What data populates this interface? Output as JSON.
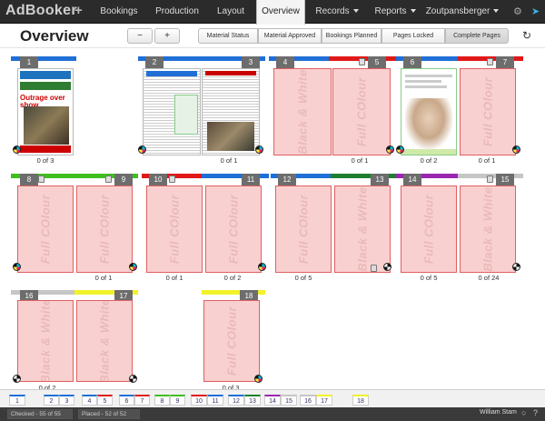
{
  "nav": {
    "logo": "AdBooker",
    "items": [
      "Bookings",
      "Production",
      "Layout",
      "Overview",
      "Records",
      "Reports",
      "Zoutpansberger"
    ],
    "active": "Overview"
  },
  "toolbar": {
    "title": "Overview",
    "zoom_out": "−",
    "zoom_in": "+",
    "filters": [
      "Material Status",
      "Material Approved",
      "Bookings Planned",
      "Pages Locked",
      "Complete Pages"
    ],
    "active_filter": "Complete Pages"
  },
  "colors": {
    "red": "#e01818",
    "blue": "#1f6fd6",
    "green": "#3fbf1f",
    "darkgreen": "#1f7f2f",
    "purple": "#9b27b0",
    "grey": "#c6c6c6",
    "yellow": "#f2f22a"
  },
  "pages": {
    "p1": {
      "num": "1",
      "count": "0 of 3"
    },
    "p2": {
      "num": "2"
    },
    "p3": {
      "num": "3",
      "count": "0 of 1"
    },
    "p4": {
      "num": "4",
      "text": "Black & White"
    },
    "p5": {
      "num": "5",
      "text": "Full COlour",
      "count": "0 of 1"
    },
    "p6": {
      "num": "6",
      "count": "0 of 2"
    },
    "p7": {
      "num": "7",
      "text": "Full COlour",
      "count": "0 of 1"
    },
    "p8": {
      "num": "8",
      "text": "Full COlour"
    },
    "p9": {
      "num": "9",
      "text": "Full COlour",
      "count": "0 of 1"
    },
    "p10": {
      "num": "10",
      "text": "Full COlour"
    },
    "p11": {
      "num": "11",
      "text": "Full COlour",
      "count": "0 of 2"
    },
    "p12": {
      "num": "12",
      "text": "Full COlour"
    },
    "p13": {
      "num": "13",
      "text": "Black & White",
      "count": "0 of 5"
    },
    "p14": {
      "num": "14",
      "text": "Full COlour"
    },
    "p15": {
      "num": "15",
      "text": "Black & White",
      "count": "0 of 5",
      "count2": "0 of 24"
    },
    "p16": {
      "num": "16",
      "text": "Black & White"
    },
    "p17": {
      "num": "17",
      "text": "Black & White",
      "count": "0 of 2"
    },
    "p18": {
      "num": "18",
      "text": "Full COlour",
      "count": "0 of 3"
    }
  },
  "cover": {
    "headline": "Outrage over show"
  },
  "thumbs": [
    "1",
    "2",
    "3",
    "4",
    "5",
    "6",
    "7",
    "8",
    "9",
    "10",
    "11",
    "12",
    "13",
    "14",
    "15",
    "16",
    "17",
    "18"
  ],
  "status": {
    "checked": "Checked - 55 of 55",
    "placed": "Placed - 52 of 52",
    "user": "William Stam"
  }
}
